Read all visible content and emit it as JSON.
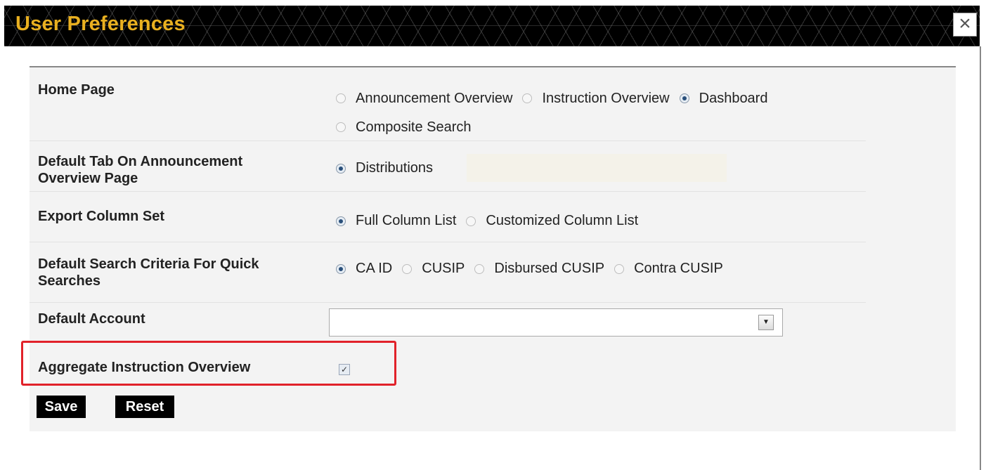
{
  "dialog": {
    "title": "User Preferences",
    "close_label": "×"
  },
  "home_page": {
    "label": "Home Page",
    "options": [
      {
        "label": "Announcement Overview",
        "checked": false
      },
      {
        "label": "Instruction Overview",
        "checked": false
      },
      {
        "label": "Dashboard",
        "checked": true
      },
      {
        "label": "Composite Search",
        "checked": false
      }
    ]
  },
  "default_tab": {
    "label": "Default Tab On Announcement Overview Page",
    "options": [
      {
        "label": "Distributions",
        "checked": true
      }
    ]
  },
  "export_column_set": {
    "label": "Export Column Set",
    "options": [
      {
        "label": "Full Column List",
        "checked": true
      },
      {
        "label": "Customized Column List",
        "checked": false
      }
    ]
  },
  "default_search": {
    "label": "Default Search Criteria For Quick Searches",
    "options": [
      {
        "label": "CA ID",
        "checked": true
      },
      {
        "label": "CUSIP",
        "checked": false
      },
      {
        "label": "Disbursed CUSIP",
        "checked": false
      },
      {
        "label": "Contra CUSIP",
        "checked": false
      }
    ]
  },
  "default_account": {
    "label": "Default Account",
    "value": "",
    "arrow": "▼"
  },
  "aggregate": {
    "label": "Aggregate Instruction Overview",
    "checked": true,
    "check_glyph": "✓"
  },
  "buttons": {
    "save": "Save",
    "reset": "Reset"
  },
  "colors": {
    "title_text": "#e9b020",
    "highlight_border": "#e1222a"
  }
}
